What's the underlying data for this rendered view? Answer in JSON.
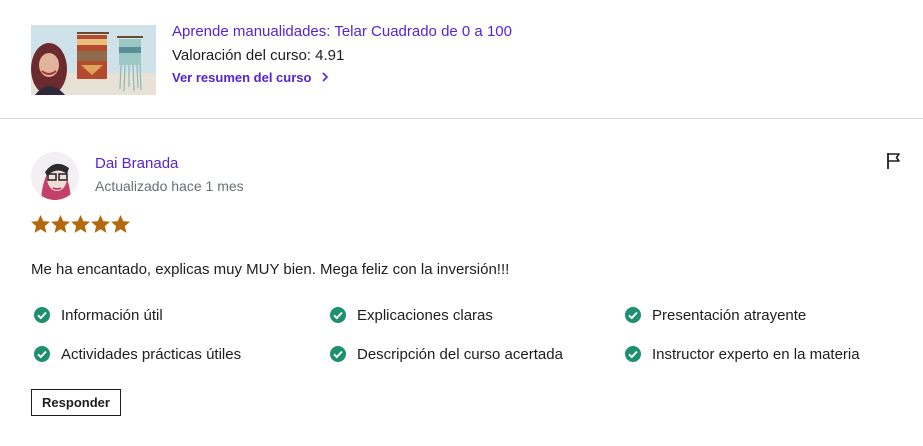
{
  "course": {
    "title": "Aprende manualidades: Telar Cuadrado de 0 a 100",
    "rating_text": "Valoración del curso: 4.91",
    "summary_link": "Ver resumen del curso",
    "summary_icon": "chevron-right-icon"
  },
  "review": {
    "reviewer_name": "Dai Branada",
    "updated": "Actualizado hace 1 mes",
    "rating": 5,
    "rating_max": 5,
    "text": "Me ha encantado, explicas muy MUY bien. Mega feliz con la inversión!!!",
    "flag_icon": "flag-icon",
    "tags": [
      "Información útil",
      "Explicaciones claras",
      "Presentación atrayente",
      "Actividades prácticas útiles",
      "Descripción del curso acertada",
      "Instructor experto en la materia"
    ],
    "reply_label": "Responder"
  },
  "colors": {
    "link_purple": "#5624d0",
    "star_orange": "#b4690e",
    "check_green": "#1e8f6f",
    "text_dark": "#1c1d1f",
    "text_muted": "#6a6f73",
    "divider": "#d1d7dc"
  }
}
